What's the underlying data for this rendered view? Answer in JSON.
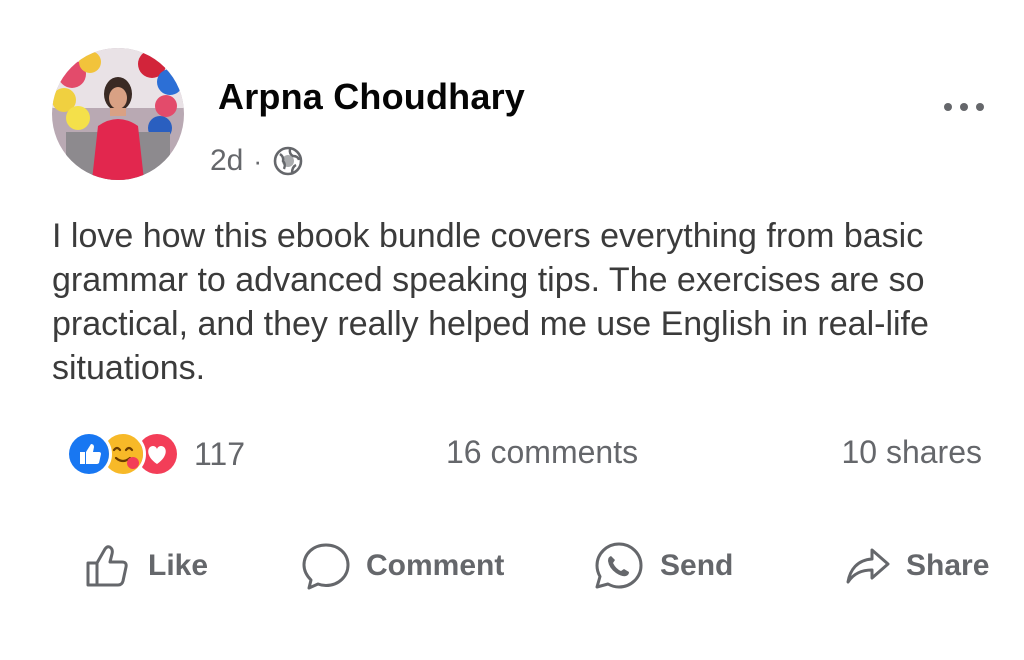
{
  "post": {
    "author": "Arpna Choudhary",
    "time": "2d",
    "separator": "·",
    "privacy_icon": "globe-icon",
    "menu_icon": "more-options-icon",
    "text": "I love how this ebook bundle covers everything from basic grammar to advanced speaking tips. The exercises are so practical, and they really helped me use English in real-life situations."
  },
  "stats": {
    "reaction_icons": [
      "like-reaction-icon",
      "care-reaction-icon",
      "love-reaction-icon"
    ],
    "reaction_count": "117",
    "comments": "16 comments",
    "shares": "10 shares"
  },
  "actions": {
    "like": "Like",
    "comment": "Comment",
    "send": "Send",
    "share": "Share"
  },
  "colors": {
    "like_blue": "#1877f2",
    "love_red": "#f33e58",
    "care_yellow": "#f7b928",
    "secondary_text": "#65676b"
  }
}
